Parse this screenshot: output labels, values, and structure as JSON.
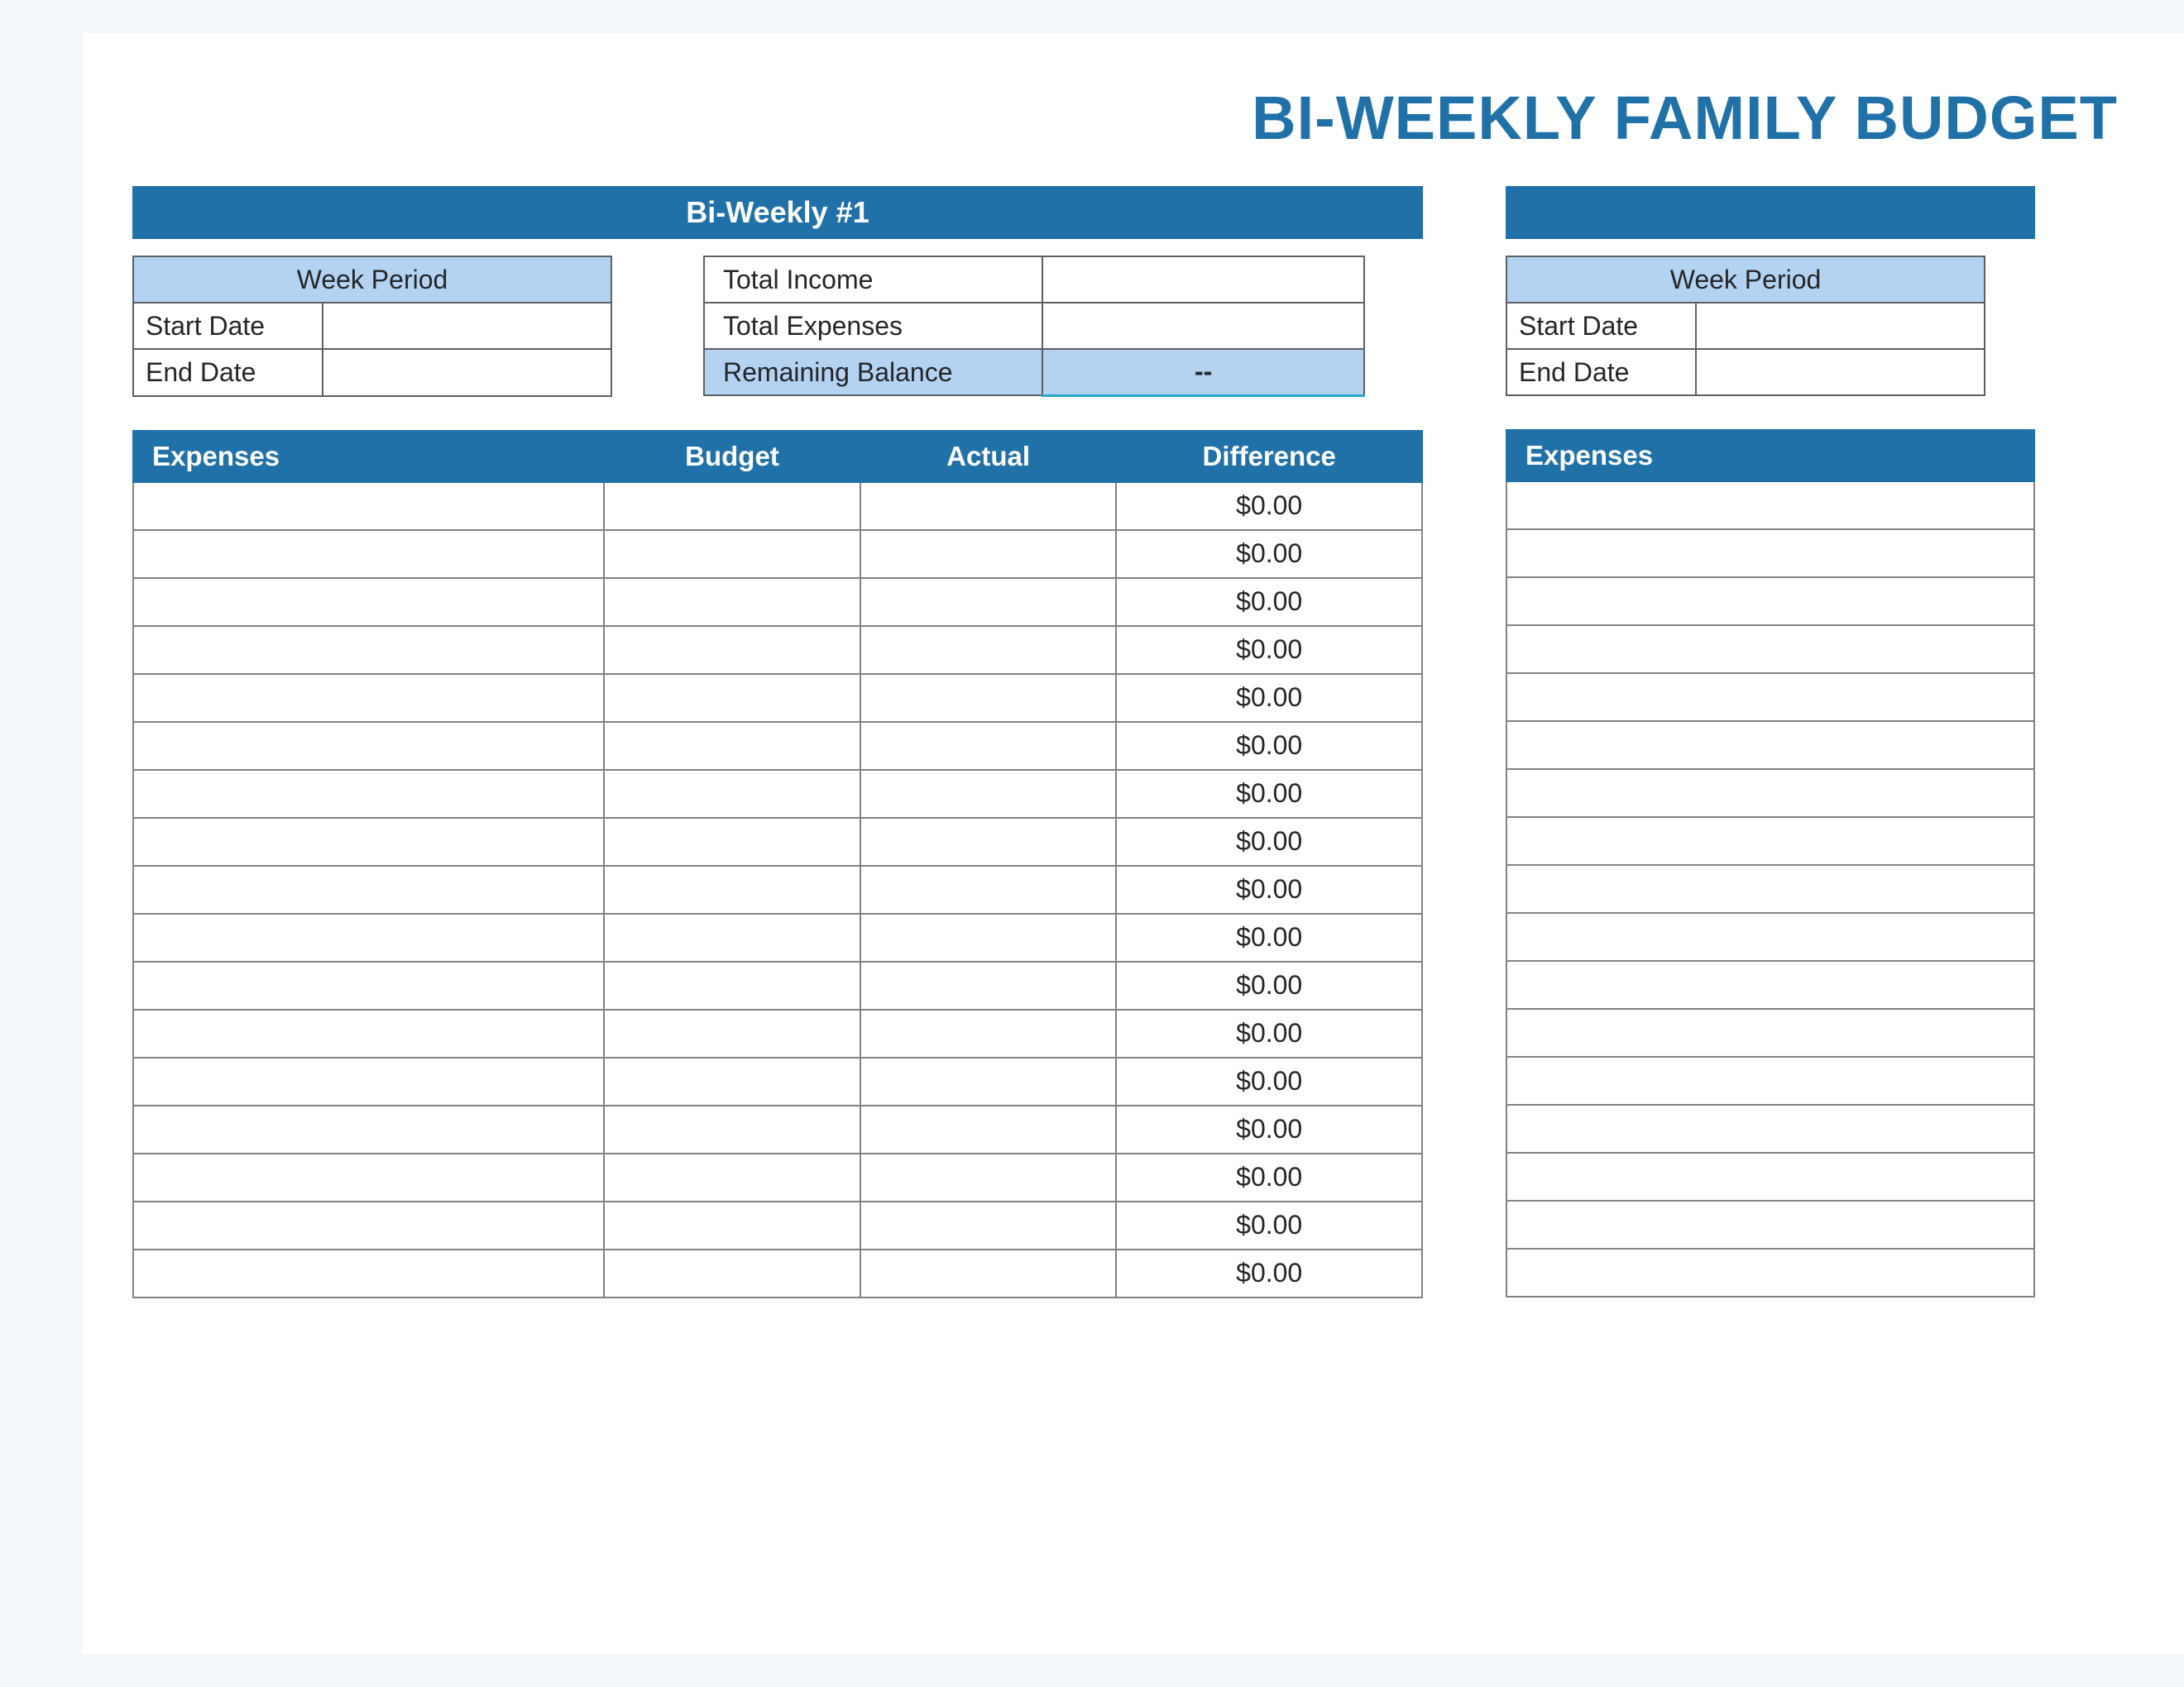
{
  "title": "BI-WEEKLY FAMILY BUDGET",
  "section1": {
    "bar_label": "Bi-Weekly #1",
    "week_period_header": "Week Period",
    "start_date_label": "Start Date",
    "start_date_value": "",
    "end_date_label": "End Date",
    "end_date_value": "",
    "totals": {
      "income_label": "Total Income",
      "income_value": "",
      "expenses_label": "Total Expenses",
      "expenses_value": "",
      "balance_label": "Remaining Balance",
      "balance_value": "--"
    },
    "table_headers": {
      "expenses": "Expenses",
      "budget": "Budget",
      "actual": "Actual",
      "difference": "Difference"
    },
    "rows": [
      {
        "expense": "",
        "budget": "",
        "actual": "",
        "difference": "$0.00"
      },
      {
        "expense": "",
        "budget": "",
        "actual": "",
        "difference": "$0.00"
      },
      {
        "expense": "",
        "budget": "",
        "actual": "",
        "difference": "$0.00"
      },
      {
        "expense": "",
        "budget": "",
        "actual": "",
        "difference": "$0.00"
      },
      {
        "expense": "",
        "budget": "",
        "actual": "",
        "difference": "$0.00"
      },
      {
        "expense": "",
        "budget": "",
        "actual": "",
        "difference": "$0.00"
      },
      {
        "expense": "",
        "budget": "",
        "actual": "",
        "difference": "$0.00"
      },
      {
        "expense": "",
        "budget": "",
        "actual": "",
        "difference": "$0.00"
      },
      {
        "expense": "",
        "budget": "",
        "actual": "",
        "difference": "$0.00"
      },
      {
        "expense": "",
        "budget": "",
        "actual": "",
        "difference": "$0.00"
      },
      {
        "expense": "",
        "budget": "",
        "actual": "",
        "difference": "$0.00"
      },
      {
        "expense": "",
        "budget": "",
        "actual": "",
        "difference": "$0.00"
      },
      {
        "expense": "",
        "budget": "",
        "actual": "",
        "difference": "$0.00"
      },
      {
        "expense": "",
        "budget": "",
        "actual": "",
        "difference": "$0.00"
      },
      {
        "expense": "",
        "budget": "",
        "actual": "",
        "difference": "$0.00"
      },
      {
        "expense": "",
        "budget": "",
        "actual": "",
        "difference": "$0.00"
      },
      {
        "expense": "",
        "budget": "",
        "actual": "",
        "difference": "$0.00"
      }
    ]
  },
  "section2": {
    "bar_label": "",
    "week_period_header": "Week Period",
    "start_date_label": "Start Date",
    "start_date_value": "",
    "end_date_label": "End Date",
    "end_date_value": "",
    "table_headers": {
      "expenses": "Expenses"
    },
    "rows": [
      {
        "expense": ""
      },
      {
        "expense": ""
      },
      {
        "expense": ""
      },
      {
        "expense": ""
      },
      {
        "expense": ""
      },
      {
        "expense": ""
      },
      {
        "expense": ""
      },
      {
        "expense": ""
      },
      {
        "expense": ""
      },
      {
        "expense": ""
      },
      {
        "expense": ""
      },
      {
        "expense": ""
      },
      {
        "expense": ""
      },
      {
        "expense": ""
      },
      {
        "expense": ""
      },
      {
        "expense": ""
      },
      {
        "expense": ""
      }
    ]
  }
}
